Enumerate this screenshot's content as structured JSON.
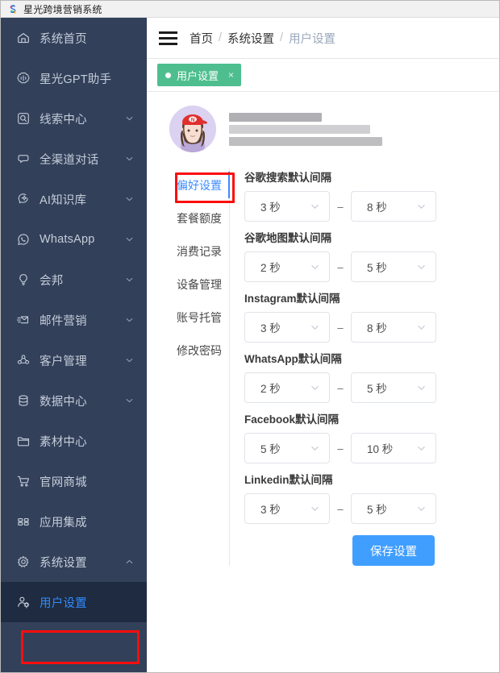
{
  "window": {
    "title": "星光跨境营销系统",
    "logo_icon": "s-logo-icon"
  },
  "sidebar": {
    "items": [
      {
        "label": "系统首页",
        "icon": "home-icon",
        "expandable": false,
        "active": false
      },
      {
        "label": "星光GPT助手",
        "icon": "gpt-icon",
        "expandable": false,
        "active": false
      },
      {
        "label": "线索中心",
        "icon": "lead-search-icon",
        "expandable": true,
        "active": false
      },
      {
        "label": "全渠道对话",
        "icon": "chat-bubble-icon",
        "expandable": true,
        "active": false
      },
      {
        "label": "AI知识库",
        "icon": "ai-brain-icon",
        "expandable": true,
        "active": false
      },
      {
        "label": "WhatsApp",
        "icon": "whatsapp-icon",
        "expandable": true,
        "active": false
      },
      {
        "label": "会邦",
        "icon": "lightbulb-icon",
        "expandable": true,
        "active": false
      },
      {
        "label": "邮件营销",
        "icon": "mail-send-icon",
        "expandable": true,
        "active": false
      },
      {
        "label": "客户管理",
        "icon": "customers-icon",
        "expandable": true,
        "active": false
      },
      {
        "label": "数据中心",
        "icon": "database-icon",
        "expandable": true,
        "active": false
      },
      {
        "label": "素材中心",
        "icon": "folder-icon",
        "expandable": false,
        "active": false
      },
      {
        "label": "官网商城",
        "icon": "shopping-cart-icon",
        "expandable": false,
        "active": false
      },
      {
        "label": "应用集成",
        "icon": "grid-apps-icon",
        "expandable": false,
        "active": false
      },
      {
        "label": "系统设置",
        "icon": "gear-icon",
        "expandable": true,
        "expanded": true,
        "active": false
      },
      {
        "label": "用户设置",
        "icon": "user-settings-icon",
        "expandable": false,
        "active": true
      }
    ]
  },
  "topbar": {
    "menu_toggle_icon": "hamburger-icon",
    "breadcrumb": [
      {
        "label": "首页"
      },
      {
        "label": "系统设置"
      },
      {
        "label": "用户设置",
        "current": true
      }
    ],
    "separator": "/"
  },
  "page_tabs": [
    {
      "label": "用户设置",
      "closable": true,
      "close_glyph": "×",
      "active": true
    }
  ],
  "profile": {
    "avatar_icon": "user-avatar-icon",
    "name_redacted": true,
    "redacted_lines": [
      {
        "width": 115,
        "opacity": 0.75
      },
      {
        "width": 175,
        "opacity": 0.45
      },
      {
        "width": 190,
        "opacity": 0.62
      }
    ]
  },
  "vertical_tabs": [
    {
      "label": "偏好设置",
      "active": true
    },
    {
      "label": "套餐额度",
      "active": false
    },
    {
      "label": "消费记录",
      "active": false
    },
    {
      "label": "设备管理",
      "active": false
    },
    {
      "label": "账号托管",
      "active": false
    },
    {
      "label": "修改密码",
      "active": false
    }
  ],
  "settings_form": {
    "range_separator": "–",
    "fields": [
      {
        "label": "谷歌搜索默认间隔",
        "min_value": "3 秒",
        "max_value": "8 秒"
      },
      {
        "label": "谷歌地图默认间隔",
        "min_value": "2 秒",
        "max_value": "5 秒"
      },
      {
        "label": "Instagram默认间隔",
        "min_value": "3 秒",
        "max_value": "8 秒"
      },
      {
        "label": "WhatsApp默认间隔",
        "min_value": "2 秒",
        "max_value": "5 秒"
      },
      {
        "label": "Facebook默认间隔",
        "min_value": "5 秒",
        "max_value": "10 秒"
      },
      {
        "label": "Linkedin默认间隔",
        "min_value": "3 秒",
        "max_value": "5 秒"
      }
    ],
    "save_label": "保存设置"
  },
  "colors": {
    "sidebar_bg": "#32405a",
    "sidebar_active_bg": "#1f2b40",
    "sidebar_active_text": "#2f8cff",
    "tab_green": "#4ebe8e",
    "primary_blue": "#409eff",
    "annotation_red": "#fd0d0d"
  },
  "annotations": [
    {
      "target": "偏好设置",
      "shape": "rectangle",
      "color": "#fd0d0d"
    },
    {
      "target": "用户设置",
      "shape": "rectangle",
      "color": "#fd0d0d"
    }
  ]
}
